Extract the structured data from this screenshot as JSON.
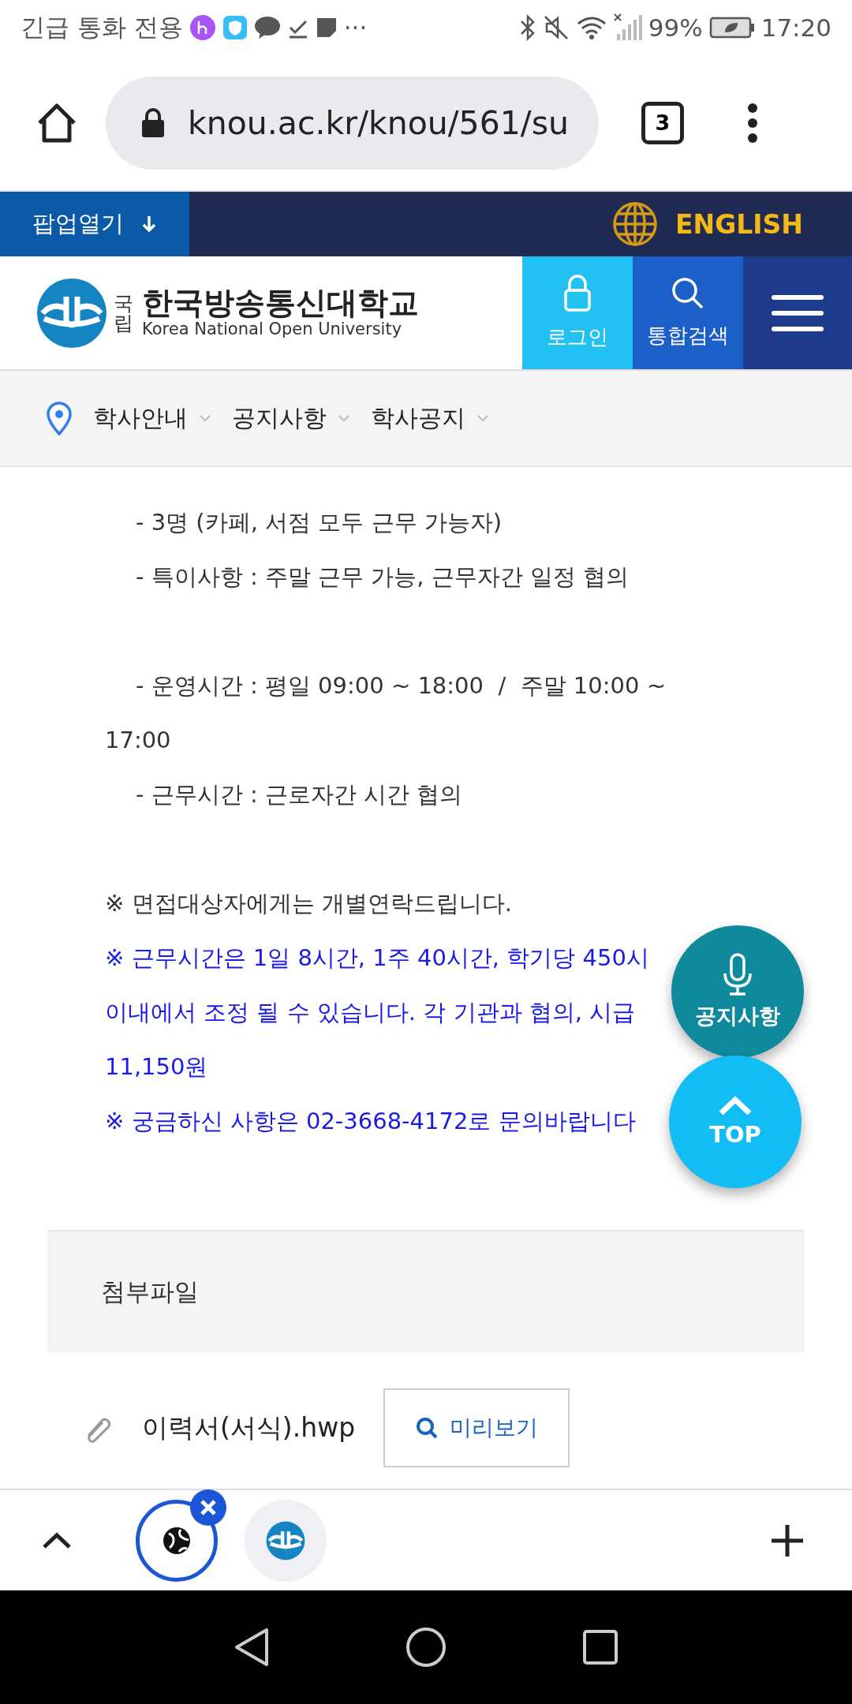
{
  "status_bar": {
    "left_text": "긴급 통화 전용",
    "more": "···",
    "battery": "99%",
    "time": "17:20"
  },
  "browser": {
    "url": "knou.ac.kr/knou/561/su",
    "tab_count": "3"
  },
  "top_bar": {
    "popup_button": "팝업열기",
    "language_link": "ENGLISH"
  },
  "header": {
    "logo_small": "국립",
    "logo_name": "한국방송통신대학교",
    "logo_english": "Korea National Open University",
    "login": "로그인",
    "search": "통합검색"
  },
  "breadcrumb": [
    "학사안내",
    "공지사항",
    "학사공지"
  ],
  "content_lines": [
    {
      "kind": "text",
      "indent": true,
      "color": "#333333",
      "text": "- 3명 (카페, 서점 모두 근무 가능자)"
    },
    {
      "kind": "text",
      "indent": true,
      "color": "#333333",
      "text": "- 특이사항 : 주말 근무 가능, 근무자간 일정 협의"
    },
    {
      "kind": "gap"
    },
    {
      "kind": "text",
      "indent": true,
      "color": "#333333",
      "text": "- 운영시간 : 평일 09:00 ~ 18:00  /  주말 10:00 ~"
    },
    {
      "kind": "text",
      "indent": false,
      "color": "#333333",
      "text": "17:00"
    },
    {
      "kind": "text",
      "indent": true,
      "color": "#333333",
      "text": "- 근무시간 : 근로자간 시간 협의"
    },
    {
      "kind": "gap"
    },
    {
      "kind": "text",
      "indent": false,
      "color": "#333333",
      "text": "※ 면접대상자에게는 개별연락드립니다."
    },
    {
      "kind": "text",
      "indent": false,
      "color": "#1a1ae6",
      "text": "※ 근무시간은 1일 8시간, 1주 40시간, 학기당 450시"
    },
    {
      "kind": "text",
      "indent": false,
      "color": "#1a1ae6",
      "text": "이내에서 조정 될 수 있습니다. 각 기관과 협의, 시급"
    },
    {
      "kind": "text",
      "indent": false,
      "color": "#1a1ae6",
      "text": "11,150원"
    },
    {
      "kind": "text",
      "indent": false,
      "color": "#1a1ae6",
      "text": "※ 궁금하신 사항은 02-3668-4172로 문의바랍니다"
    }
  ],
  "floating": {
    "notice_button": "공지사항",
    "top_button": "TOP"
  },
  "attachments": {
    "title": "첨부파일",
    "files": [
      {
        "name": "이력서(서식).hwp",
        "preview": "미리보기"
      }
    ]
  }
}
